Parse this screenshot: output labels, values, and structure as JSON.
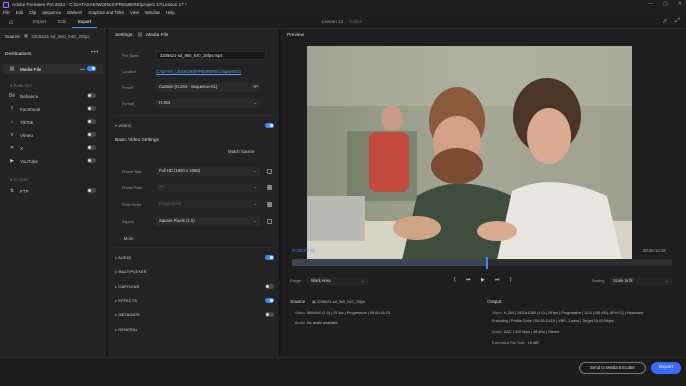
{
  "titlebar": {
    "title": "Adobe Premiere Pro 2024 - C:\\DATASAE\\WORKS\\PREMIERE\\project 17\\Lesson 17 *"
  },
  "menubar": [
    "File",
    "Edit",
    "Clip",
    "Sequence",
    "Markers",
    "Graphics and Titles",
    "View",
    "Window",
    "Help"
  ],
  "topnav": {
    "tabs": [
      "Import",
      "Edit",
      "Export"
    ],
    "active_tab": "Export",
    "project_name": "Lesson 12",
    "project_state": "Edited"
  },
  "left": {
    "source_label": "Source:",
    "source_file": "3205621-sd_960_540_25fps",
    "destinations_label": "Destinations",
    "media_file_label": "Media File",
    "publish_group": "PUBLISH",
    "publish_items": [
      "Behance",
      "Facebook",
      "TikTok",
      "Vimeo",
      "X",
      "YouTube"
    ],
    "cloud_group": "CLOUD",
    "cloud_items": [
      "FTP"
    ]
  },
  "settings": {
    "header": "Settings:",
    "header_target": "Media File",
    "file_name_label": "File Name",
    "file_name_value": "3205621-sd_960_540_25fps.mp4",
    "location_label": "Location",
    "location_value": "C:\\DATA\\_LESSONS\\PREMIERE\\chapters\\01",
    "preset_label": "Preset",
    "preset_value": "Custom (H.264 - Sequence-01)",
    "format_label": "Format",
    "format_value": "H.264",
    "video_section": "VIDEO",
    "basic_video_settings": "Basic Video Settings",
    "match_source": "Match Source",
    "frame_size_label": "Frame Size",
    "frame_size_value": "Full HD (1920 x 1080)",
    "frame_rate_label": "Frame Rate",
    "frame_rate_value": "25",
    "field_order_label": "Field Order",
    "field_order_value": "Progressive",
    "aspect_label": "Aspect",
    "aspect_value": "Square Pixels (1.0)",
    "more_label": "More",
    "sections": [
      "AUDIO",
      "MULTIPLEXER",
      "CAPTIONS",
      "EFFECTS",
      "METADATA",
      "GENERAL"
    ]
  },
  "preview": {
    "label": "Preview",
    "timecode_current": "00:00:07:12",
    "timecode_total": "00:00:14:19",
    "playback_position": 0.51,
    "range_label": "Range",
    "range_value": "Work Area",
    "scaling_label": "Scaling",
    "scaling_value": "Scale to fit"
  },
  "summary": {
    "source_label": "Source",
    "source_file": "3205621-sd_960_540_25fps",
    "source_video_key": "Video",
    "source_video_value": "960x540 (1.0) | 25 fps | Progressive | 00:00:14:19",
    "source_audio_key": "Audio",
    "source_audio_value": "No audio available",
    "output_label": "Output",
    "output_video_key": "Video",
    "output_video_value_1": "H.264 | 1920x1080 (1.0) | 25 fps | Progressive | 20.0 (156 KB), 50% FQ | Hardware",
    "output_video_value_2": "Encoding | Profile Color | 00:00:14:19 | VBR, 1 pass | Target 10.00 Mbps",
    "output_audio_key": "Audio",
    "output_audio_value": "AAC | 320 kbps | 48 kHz | Stereo",
    "filesize_label": "Estimated File Size:",
    "filesize_value": "19 MB"
  },
  "bottom": {
    "send_to_encoder": "Send to Media Encoder",
    "export": "Export"
  },
  "colors": {
    "accent": "#3a8bff",
    "export_button": "#3a6bff"
  }
}
